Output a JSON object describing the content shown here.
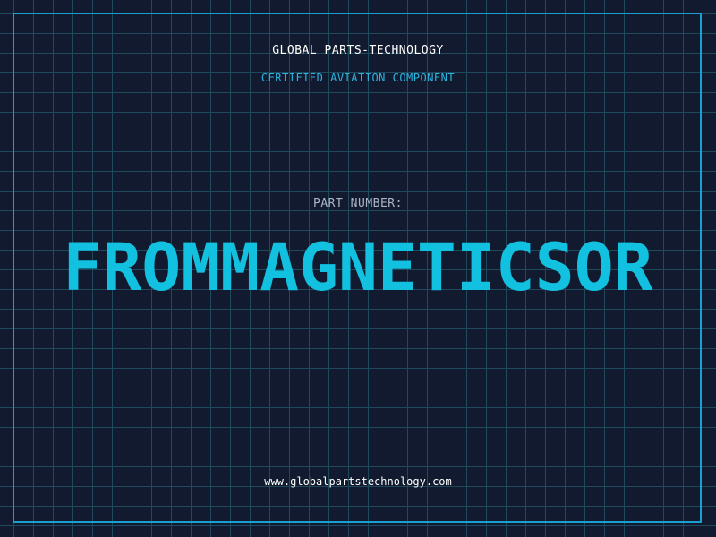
{
  "header": {
    "company": "GLOBAL PARTS-TECHNOLOGY",
    "tagline": "CERTIFIED AVIATION COMPONENT"
  },
  "part": {
    "label": "PART NUMBER:",
    "number": "FROMMAGNETICSOR"
  },
  "footer": {
    "url": "www.globalpartstechnology.com"
  },
  "colors": {
    "background": "#121a2f",
    "grid": "#1f4a5c",
    "frame": "#1aa0d0",
    "accent": "#12c0e0"
  }
}
